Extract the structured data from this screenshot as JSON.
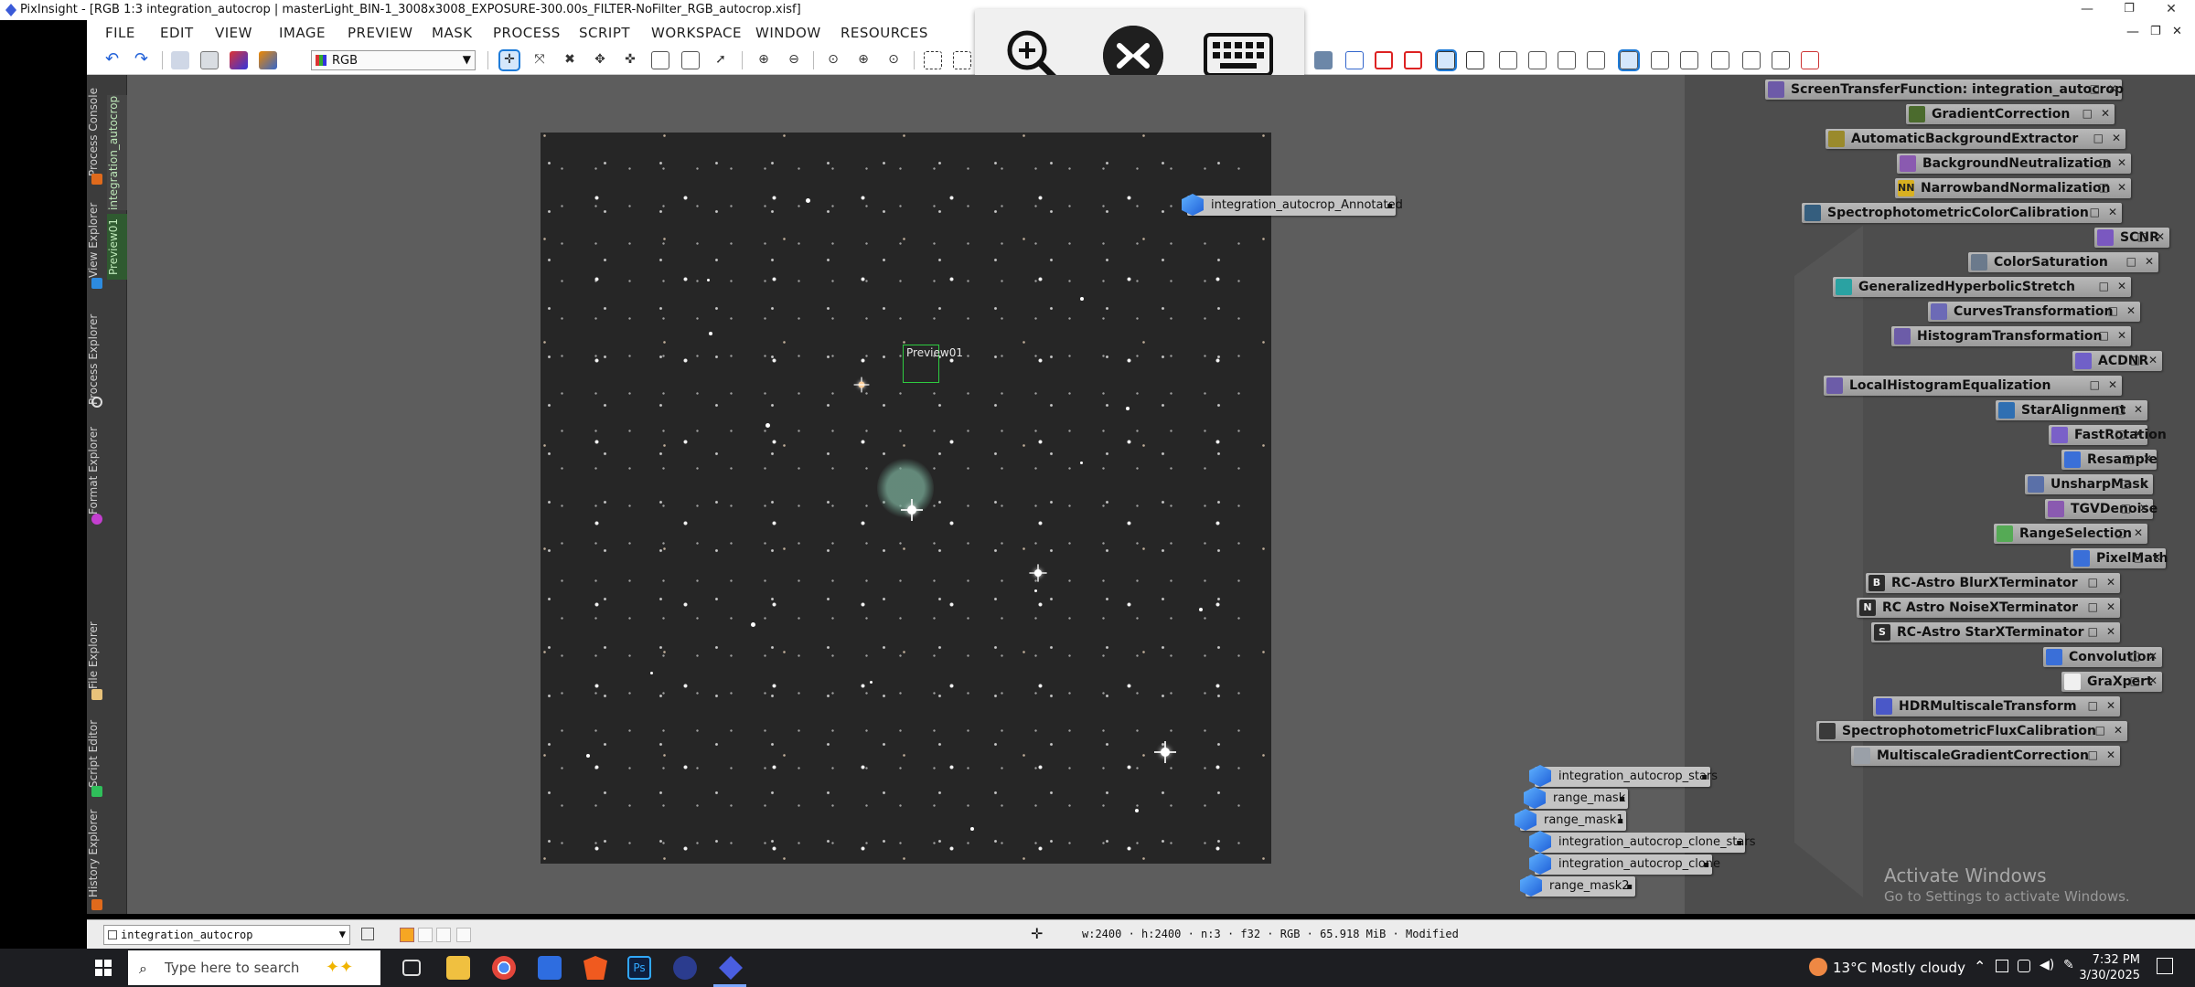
{
  "window": {
    "title": "PixInsight - [RGB 1:3 integration_autocrop | masterLight_BIN-1_3008x3008_EXPOSURE-300.00s_FILTER-NoFilter_RGB_autocrop.xisf]",
    "minimize": "—",
    "restore": "❐",
    "close": "✕"
  },
  "menu": {
    "items": [
      "FILE",
      "EDIT",
      "VIEW",
      "IMAGE",
      "PREVIEW",
      "MASK",
      "PROCESS",
      "SCRIPT",
      "WORKSPACE",
      "WINDOW",
      "RESOURCES"
    ],
    "min": "—",
    "restore": "❐",
    "close": "✕"
  },
  "toolbar": {
    "channel_select": "RGB"
  },
  "left_dock": {
    "tabs": [
      "Process Console",
      "View Explorer",
      "Process Explorer",
      "Format Explorer",
      "File Explorer",
      "Script Editor",
      "History Explorer"
    ],
    "view_tabs": [
      "integration_autocrop",
      "Preview01"
    ]
  },
  "image": {
    "preview_label": "Preview01"
  },
  "image_icons": [
    "integration_autocrop_Annotated",
    "integration_autocrop_stars",
    "range_mask",
    "range_mask1",
    "integration_autocrop_clone_stars",
    "integration_autocrop_clone",
    "range_mask2"
  ],
  "process_icons": [
    "ScreenTransferFunction: integration_autocrop",
    "GradientCorrection",
    "AutomaticBackgroundExtractor",
    "BackgroundNeutralization",
    "NarrowbandNormalization",
    "SpectrophotometricColorCalibration",
    "SCNR",
    "ColorSaturation",
    "GeneralizedHyperbolicStretch",
    "CurvesTransformation",
    "HistogramTransformation",
    "ACDNR",
    "LocalHistogramEqualization",
    "StarAlignment",
    "FastRotation",
    "Resample",
    "UnsharpMask",
    "TGVDenoise",
    "RangeSelection",
    "PixelMath",
    "RC-Astro BlurXTerminator",
    "RC Astro NoiseXTerminator",
    "RC-Astro StarXTerminator",
    "Convolution",
    "GraXpert",
    "HDRMultiscaleTransform",
    "SpectrophotometricFluxCalibration",
    "MultiscaleGradientCorrection"
  ],
  "process_icon_badges": {
    "NarrowbandNormalization": "NN",
    "RC-Astro BlurXTerminator": "B",
    "RC Astro NoiseXTerminator": "N",
    "RC-Astro StarXTerminator": "S"
  },
  "watermark": {
    "line1": "Activate Windows",
    "line2": "Go to Settings to activate Windows."
  },
  "statusbar": {
    "view": "integration_autocrop",
    "info": "w:2400 · h:2400 · n:3 · f32 · RGB · 65.918 MiB · Modified"
  },
  "taskbar": {
    "search_placeholder": "Type here to search",
    "weather": "13°C  Mostly cloudy",
    "time": "7:32 PM",
    "date": "3/30/2025"
  },
  "colors": {
    "accent": "#1e7bd8",
    "workspace": "#5d5d5d",
    "preview_border": "#2ecc40"
  }
}
